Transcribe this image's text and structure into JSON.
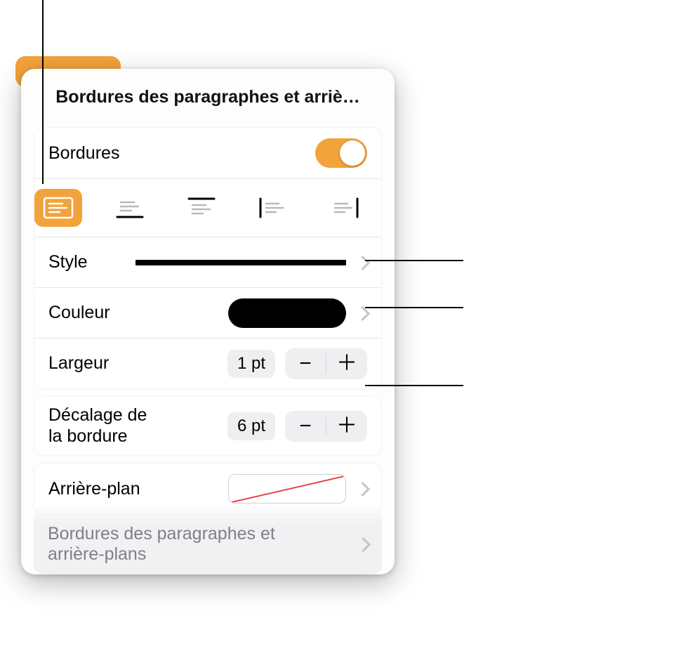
{
  "panel": {
    "title": "Bordures des paragraphes et arriè…",
    "borders": {
      "label": "Bordures",
      "enabled": true,
      "positions": [
        "all",
        "bottom",
        "top",
        "left",
        "right"
      ],
      "selected": "all"
    },
    "style": {
      "label": "Style",
      "preview": "solid"
    },
    "color": {
      "label": "Couleur",
      "value": "#000000"
    },
    "width": {
      "label": "Largeur",
      "value": "1 pt"
    },
    "offset": {
      "label": "Décalage de\nla bordure",
      "value": "6 pt"
    },
    "background": {
      "label": "Arrière-plan",
      "fill": "none"
    },
    "footer_item": {
      "label": "Bordures des paragraphes et\narrière-plans"
    }
  },
  "colors": {
    "accent": "#f2a33c"
  }
}
